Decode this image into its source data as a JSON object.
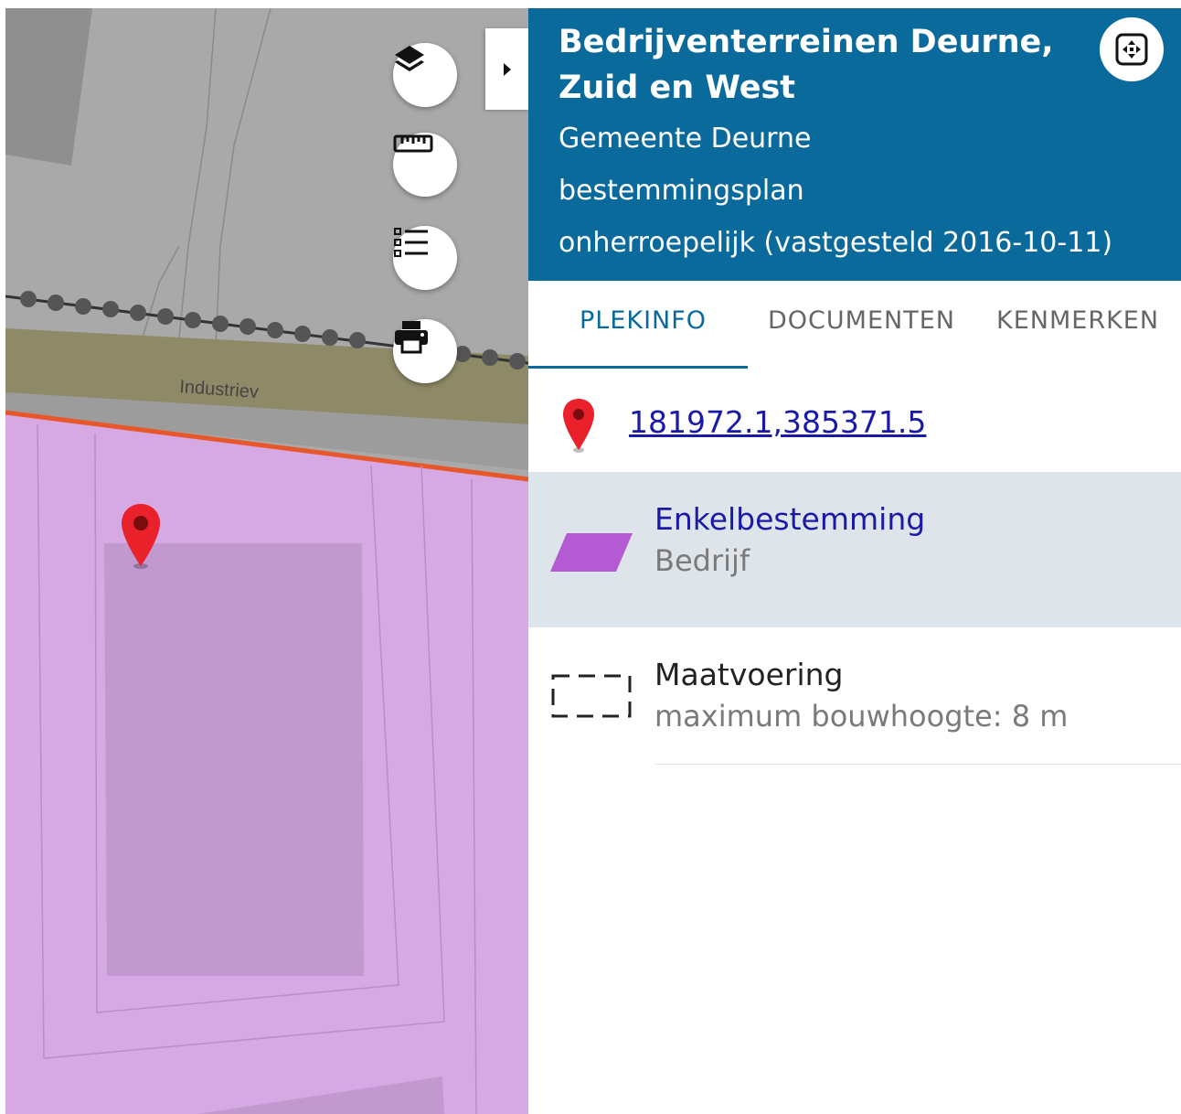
{
  "map": {
    "street_label": "Industriev",
    "buttons": [
      {
        "name": "layers",
        "icon": "layers-icon"
      },
      {
        "name": "measure",
        "icon": "ruler-icon"
      },
      {
        "name": "legend",
        "icon": "list-icon"
      },
      {
        "name": "print",
        "icon": "printer-icon"
      }
    ],
    "panel_toggle_icon": "caret-right-icon",
    "marker_icon": "map-pin-icon",
    "colors": {
      "zone_fill": "#d7a9e4",
      "zone_inner": "#c199cf",
      "road": "#8e8a68",
      "boundary": "#e8572a",
      "background": "#a9a9a9"
    }
  },
  "panel": {
    "title": "Bedrijventerreinen Deurne, Zuid en West",
    "organisation": "Gemeente Deurne",
    "plan_type": "bestemmingsplan",
    "status": "onherroepelijk (vastgesteld 2016-10-11)",
    "fullscreen_icon": "fullscreen-icon",
    "header_color": "#0a6a9b"
  },
  "tabs": [
    {
      "label": "PLEKINFO",
      "active": true
    },
    {
      "label": "DOCUMENTEN",
      "active": false
    },
    {
      "label": "KENMERKEN",
      "active": false
    }
  ],
  "location": {
    "coordinates": "181972.1,385371.5",
    "icon": "map-pin-icon"
  },
  "items": [
    {
      "title": "Enkelbestemming",
      "subtitle": "Bedrijf",
      "icon": "parallelogram-swatch-icon",
      "swatch_color": "#b45ad3"
    },
    {
      "title": "Maatvoering",
      "subtitle": "maximum bouwhoogte: 8 m",
      "icon": "dashed-box-icon"
    }
  ]
}
